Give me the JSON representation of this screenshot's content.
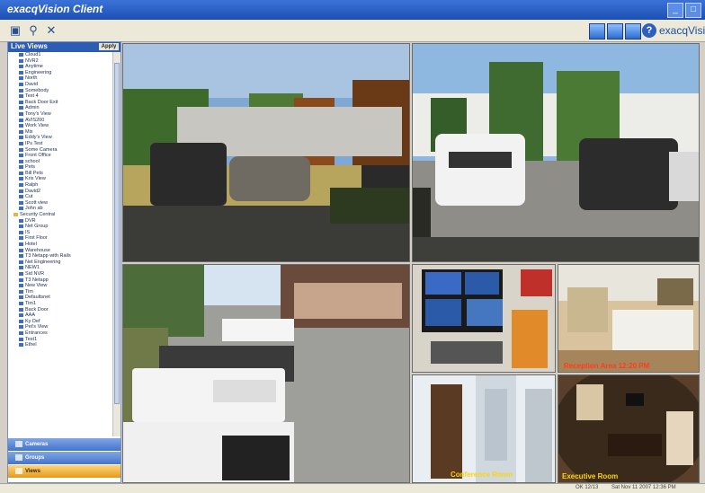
{
  "window": {
    "title": "exacqVision Client",
    "min": "_",
    "max": "□"
  },
  "toolbar": {
    "brand": "exacqVision"
  },
  "sidebar": {
    "header": "Live Views",
    "apply_label": "Apply",
    "items": [
      {
        "label": "Cloud1",
        "folder": false
      },
      {
        "label": "NVR2",
        "folder": false
      },
      {
        "label": "Anytime",
        "folder": false
      },
      {
        "label": "Engineering",
        "folder": false
      },
      {
        "label": "North",
        "folder": false
      },
      {
        "label": "David",
        "folder": false
      },
      {
        "label": "Somebody",
        "folder": false
      },
      {
        "label": "Test 4",
        "folder": false
      },
      {
        "label": "Back Door Exit",
        "folder": false
      },
      {
        "label": "Admin",
        "folder": false
      },
      {
        "label": "Tony's View",
        "folder": false
      },
      {
        "label": "AVIS200",
        "folder": false
      },
      {
        "label": "Work View",
        "folder": false
      },
      {
        "label": "Mix",
        "folder": false
      },
      {
        "label": "Eddy's View",
        "folder": false
      },
      {
        "label": "IPs Test",
        "folder": false
      },
      {
        "label": "Some Camera",
        "folder": false
      },
      {
        "label": "Front Office",
        "folder": false
      },
      {
        "label": "school",
        "folder": false
      },
      {
        "label": "Pets",
        "folder": false
      },
      {
        "label": "Bill Pets",
        "folder": false
      },
      {
        "label": "Kris View",
        "folder": false
      },
      {
        "label": "Ralph",
        "folder": false
      },
      {
        "label": "David2",
        "folder": false
      },
      {
        "label": "Cut",
        "folder": false
      },
      {
        "label": "Scott view",
        "folder": false
      },
      {
        "label": "John ab",
        "folder": false
      },
      {
        "label": "Security Central",
        "folder": true
      },
      {
        "label": "DVR",
        "folder": false
      },
      {
        "label": "Net Group",
        "folder": false
      },
      {
        "label": "IS",
        "folder": false
      },
      {
        "label": "First Floor",
        "folder": false
      },
      {
        "label": "Hotel",
        "folder": false
      },
      {
        "label": "Warehouse",
        "folder": false
      },
      {
        "label": "T3 Netapp with Rails",
        "folder": false
      },
      {
        "label": "Net Engineering",
        "folder": false
      },
      {
        "label": "NEW1",
        "folder": false
      },
      {
        "label": "Sid NVR",
        "folder": false
      },
      {
        "label": "T3 Netapp",
        "folder": false
      },
      {
        "label": "New View",
        "folder": false
      },
      {
        "label": "Tim",
        "folder": false
      },
      {
        "label": "Defaultsnet",
        "folder": false
      },
      {
        "label": "Tim1",
        "folder": false
      },
      {
        "label": "Back Door",
        "folder": false
      },
      {
        "label": "AAA",
        "folder": false
      },
      {
        "label": "Ky Def",
        "folder": false
      },
      {
        "label": "Pet's View",
        "folder": false
      },
      {
        "label": "Entrances",
        "folder": false
      },
      {
        "label": "Test1",
        "folder": false
      },
      {
        "label": "Ethel",
        "folder": false
      }
    ]
  },
  "nav": {
    "cameras": "Cameras",
    "groups": "Groups",
    "views": "Views"
  },
  "cameras": {
    "label_conference": "Conference Room",
    "label_reception": "Reception Area 12:20 PM",
    "label_bottom_right": "Executive Room"
  },
  "status": {
    "left": "OK 12/13",
    "right": "Sat Nov 11 2007 12:36 PM"
  },
  "colors": {
    "titlebar": "#2a5fc6",
    "accent": "#e49a1a"
  }
}
